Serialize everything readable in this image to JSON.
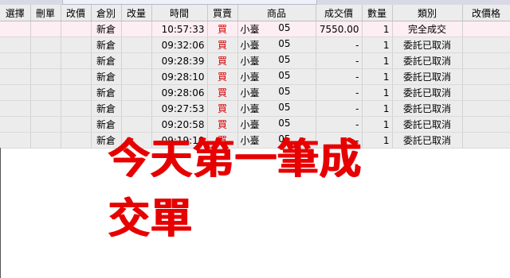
{
  "columns": [
    "選擇",
    "刪單",
    "改價",
    "倉別",
    "改量",
    "時間",
    "買賣",
    "商品",
    "成交價",
    "數量",
    "類別",
    "改價格"
  ],
  "rows": [
    {
      "warehouse": "新倉",
      "time": "10:57:33",
      "side": "買",
      "product": "小臺",
      "month": "05",
      "price": "7550.00",
      "qty": "1",
      "category": "完全成交"
    },
    {
      "warehouse": "新倉",
      "time": "09:32:06",
      "side": "買",
      "product": "小臺",
      "month": "05",
      "price": "-",
      "qty": "1",
      "category": "委託已取消"
    },
    {
      "warehouse": "新倉",
      "time": "09:28:39",
      "side": "買",
      "product": "小臺",
      "month": "05",
      "price": "-",
      "qty": "1",
      "category": "委託已取消"
    },
    {
      "warehouse": "新倉",
      "time": "09:28:10",
      "side": "買",
      "product": "小臺",
      "month": "05",
      "price": "-",
      "qty": "1",
      "category": "委託已取消"
    },
    {
      "warehouse": "新倉",
      "time": "09:28:06",
      "side": "買",
      "product": "小臺",
      "month": "05",
      "price": "-",
      "qty": "1",
      "category": "委託已取消"
    },
    {
      "warehouse": "新倉",
      "time": "09:27:53",
      "side": "買",
      "product": "小臺",
      "month": "05",
      "price": "-",
      "qty": "1",
      "category": "委託已取消"
    },
    {
      "warehouse": "新倉",
      "time": "09:20:58",
      "side": "買",
      "product": "小臺",
      "month": "05",
      "price": "-",
      "qty": "1",
      "category": "委託已取消"
    },
    {
      "warehouse": "新倉",
      "time": "09:19:10",
      "side": "買",
      "product": "小臺",
      "month": "05",
      "price": "-",
      "qty": "1",
      "category": "委託已取消"
    }
  ],
  "banner": "今天第一筆成交單",
  "colors": {
    "buy": "#d40000",
    "banner": "#e60000",
    "selected_row": "#fdeef3"
  }
}
